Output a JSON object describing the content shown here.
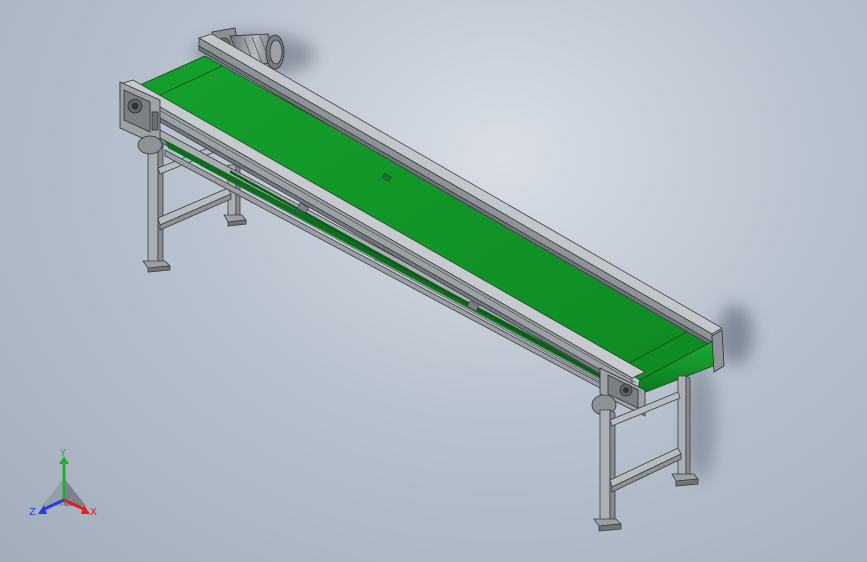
{
  "viewport": {
    "background": "#b9c2cf",
    "belt_color": "#13962a",
    "frame_color": "#aeb3b8"
  },
  "triad": {
    "y_label": "Y",
    "x_label": "X",
    "z_label": "Z",
    "colors": {
      "x": "#e02020",
      "y": "#20b030",
      "z": "#2040e0"
    }
  }
}
